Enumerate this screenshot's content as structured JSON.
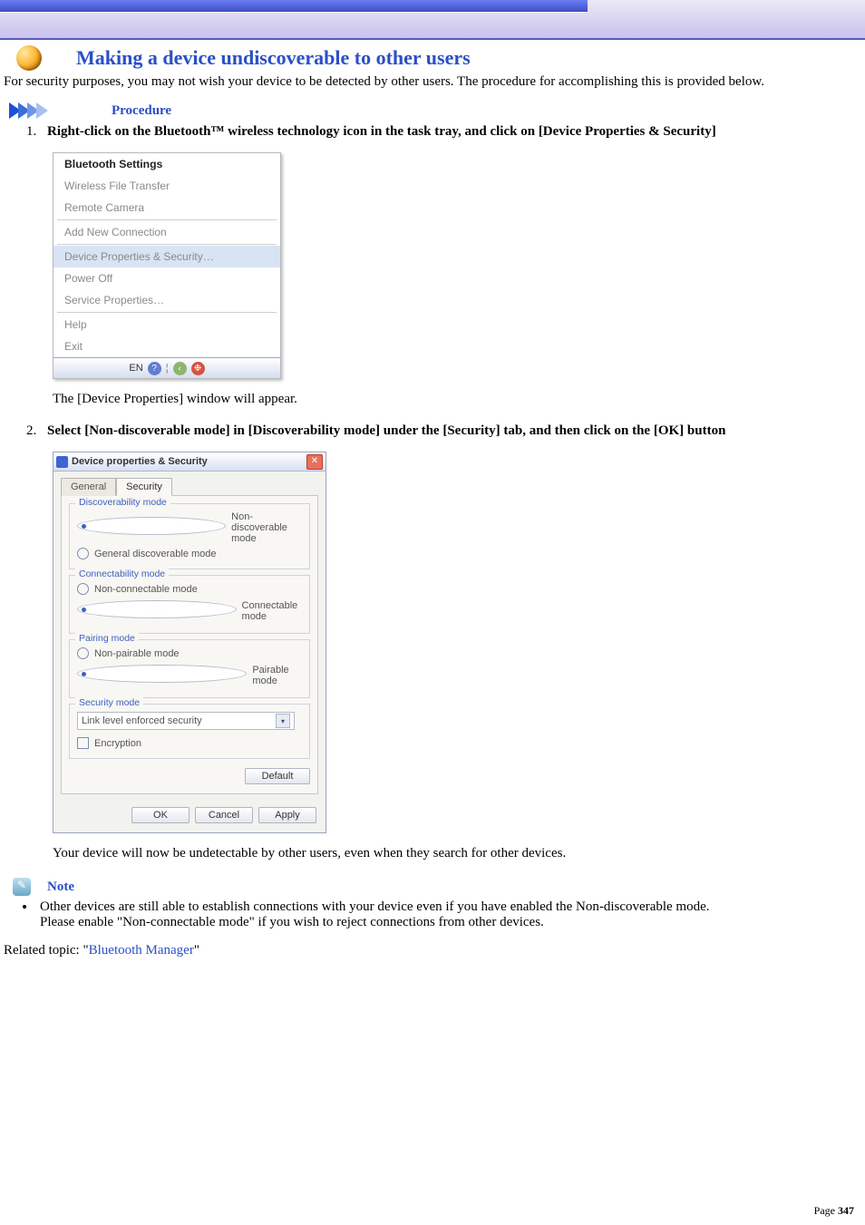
{
  "header": {
    "title": "Making a device undiscoverable to other users"
  },
  "intro": "For security purposes, you may not wish your device to be detected by other users. The procedure for accomplishing this is provided below.",
  "procedure_label": "Procedure",
  "steps": {
    "s1": "Right-click on the Bluetooth™ wireless technology icon in the task tray, and click on [Device Properties & Security]",
    "s1_followup": "The [Device Properties] window will appear.",
    "s2": "Select [Non-discoverable mode] in [Discoverability mode] under the [Security] tab, and then click on the [OK] button",
    "s2_followup": "Your device will now be undetectable by other users, even when they search for other devices."
  },
  "context_menu": {
    "m1": "Bluetooth Settings",
    "m2": "Wireless File Transfer",
    "m3": "Remote Camera",
    "m4": "Add New Connection",
    "m5": "Device Properties & Security…",
    "m6": "Power Off",
    "m7": "Service Properties…",
    "m8": "Help",
    "m9": "Exit",
    "tray_lang": "EN"
  },
  "dialog": {
    "title": "Device properties & Security",
    "tab_general": "General",
    "tab_security": "Security",
    "grp_discover": "Discoverability mode",
    "opt_nondisc": "Non-discoverable mode",
    "opt_gendisc": "General discoverable mode",
    "grp_connect": "Connectability mode",
    "opt_nonconn": "Non-connectable mode",
    "opt_conn": "Connectable mode",
    "grp_pair": "Pairing mode",
    "opt_nonpair": "Non-pairable mode",
    "opt_pair": "Pairable mode",
    "grp_sec": "Security mode",
    "sec_value": "Link level enforced security",
    "chk_enc": "Encryption",
    "btn_default": "Default",
    "btn_ok": "OK",
    "btn_cancel": "Cancel",
    "btn_apply": "Apply"
  },
  "note_label": "Note",
  "note_items": {
    "n1": "Other devices are still able to establish connections with your device even if you have enabled the Non-discoverable mode.",
    "n2": "Please enable \"Non-connectable mode\" if you wish to reject connections from other devices."
  },
  "related": {
    "prefix": "Related topic: \"",
    "link": "Bluetooth Manager",
    "suffix": "\""
  },
  "page": {
    "label": "Page ",
    "num": "347"
  }
}
